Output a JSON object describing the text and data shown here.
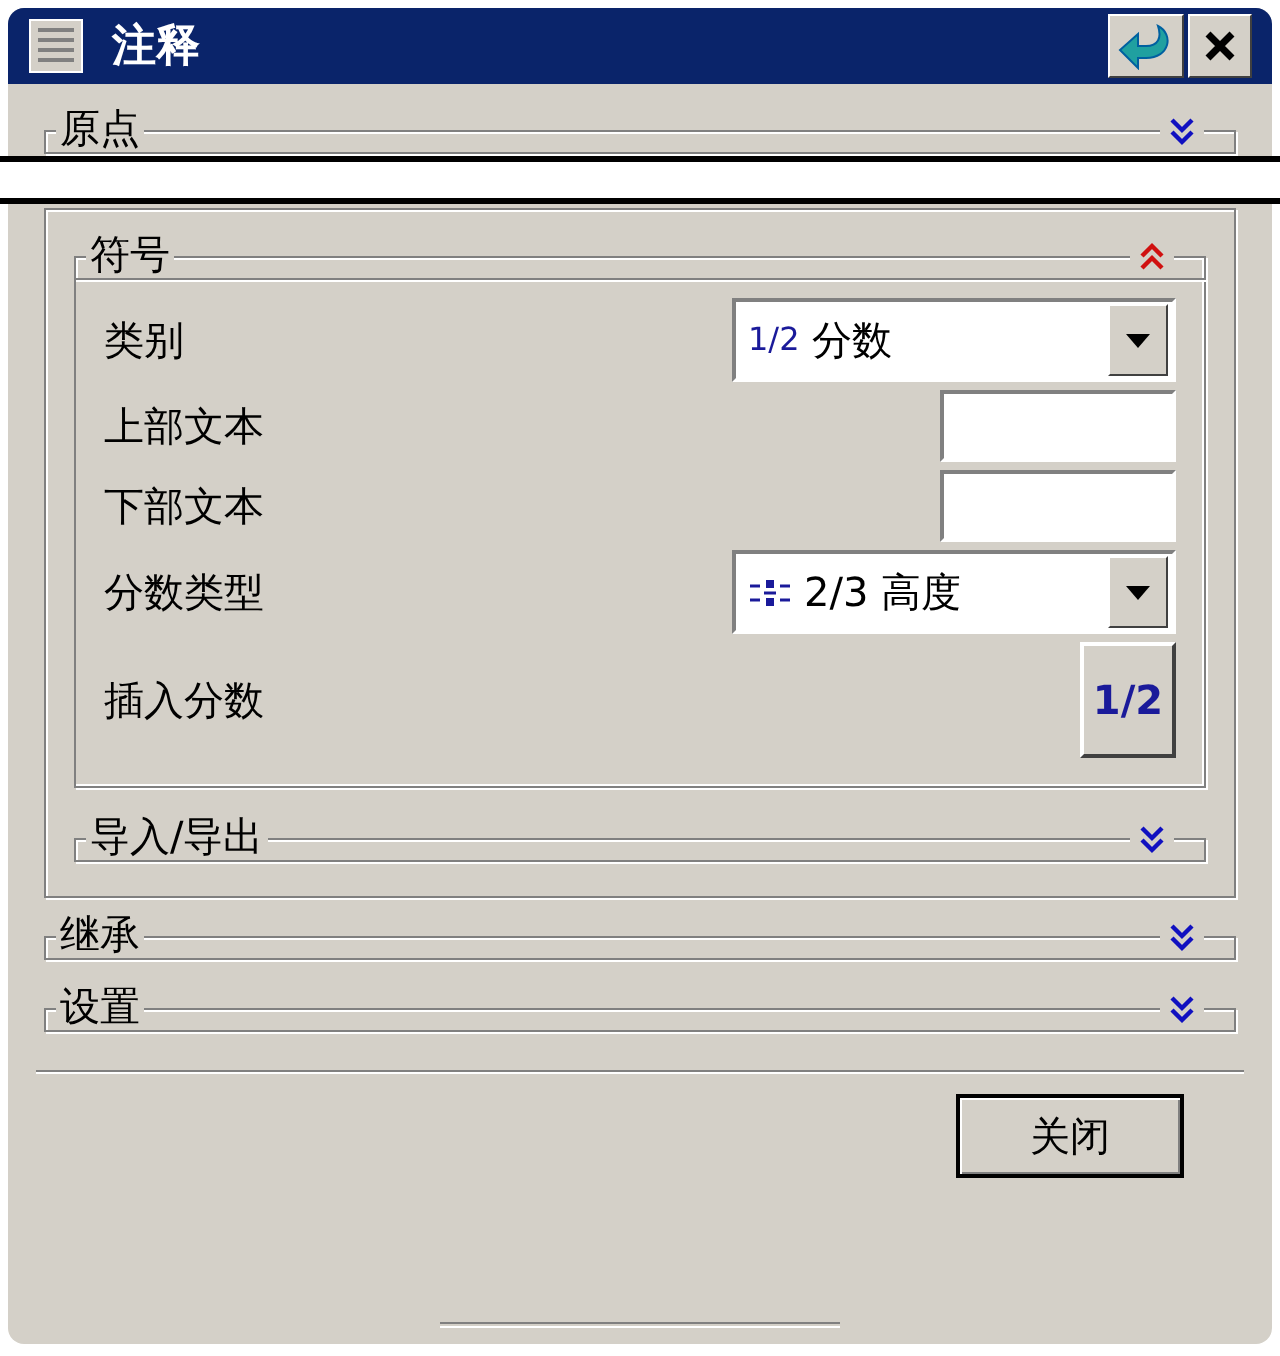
{
  "window": {
    "title": "注释"
  },
  "groups": [
    {
      "label": "原点",
      "expanded": false
    },
    {
      "label": "符号",
      "expanded": true,
      "fields": [
        {
          "kind": "dropdown",
          "label": "类别",
          "prefix": "1/2",
          "value": "分数"
        },
        {
          "kind": "text",
          "label": "上部文本"
        },
        {
          "kind": "text",
          "label": "下部文本"
        },
        {
          "kind": "dropdown",
          "label": "分数类型",
          "value": "2/3 高度"
        },
        {
          "kind": "button",
          "label": "插入分数",
          "button_text": "1/2"
        }
      ],
      "subgroups": [
        {
          "label": "导入/导出",
          "expanded": false
        }
      ]
    },
    {
      "label": "继承",
      "expanded": false
    },
    {
      "label": "设置",
      "expanded": false
    }
  ],
  "buttons": [
    {
      "label": "关闭"
    }
  ]
}
